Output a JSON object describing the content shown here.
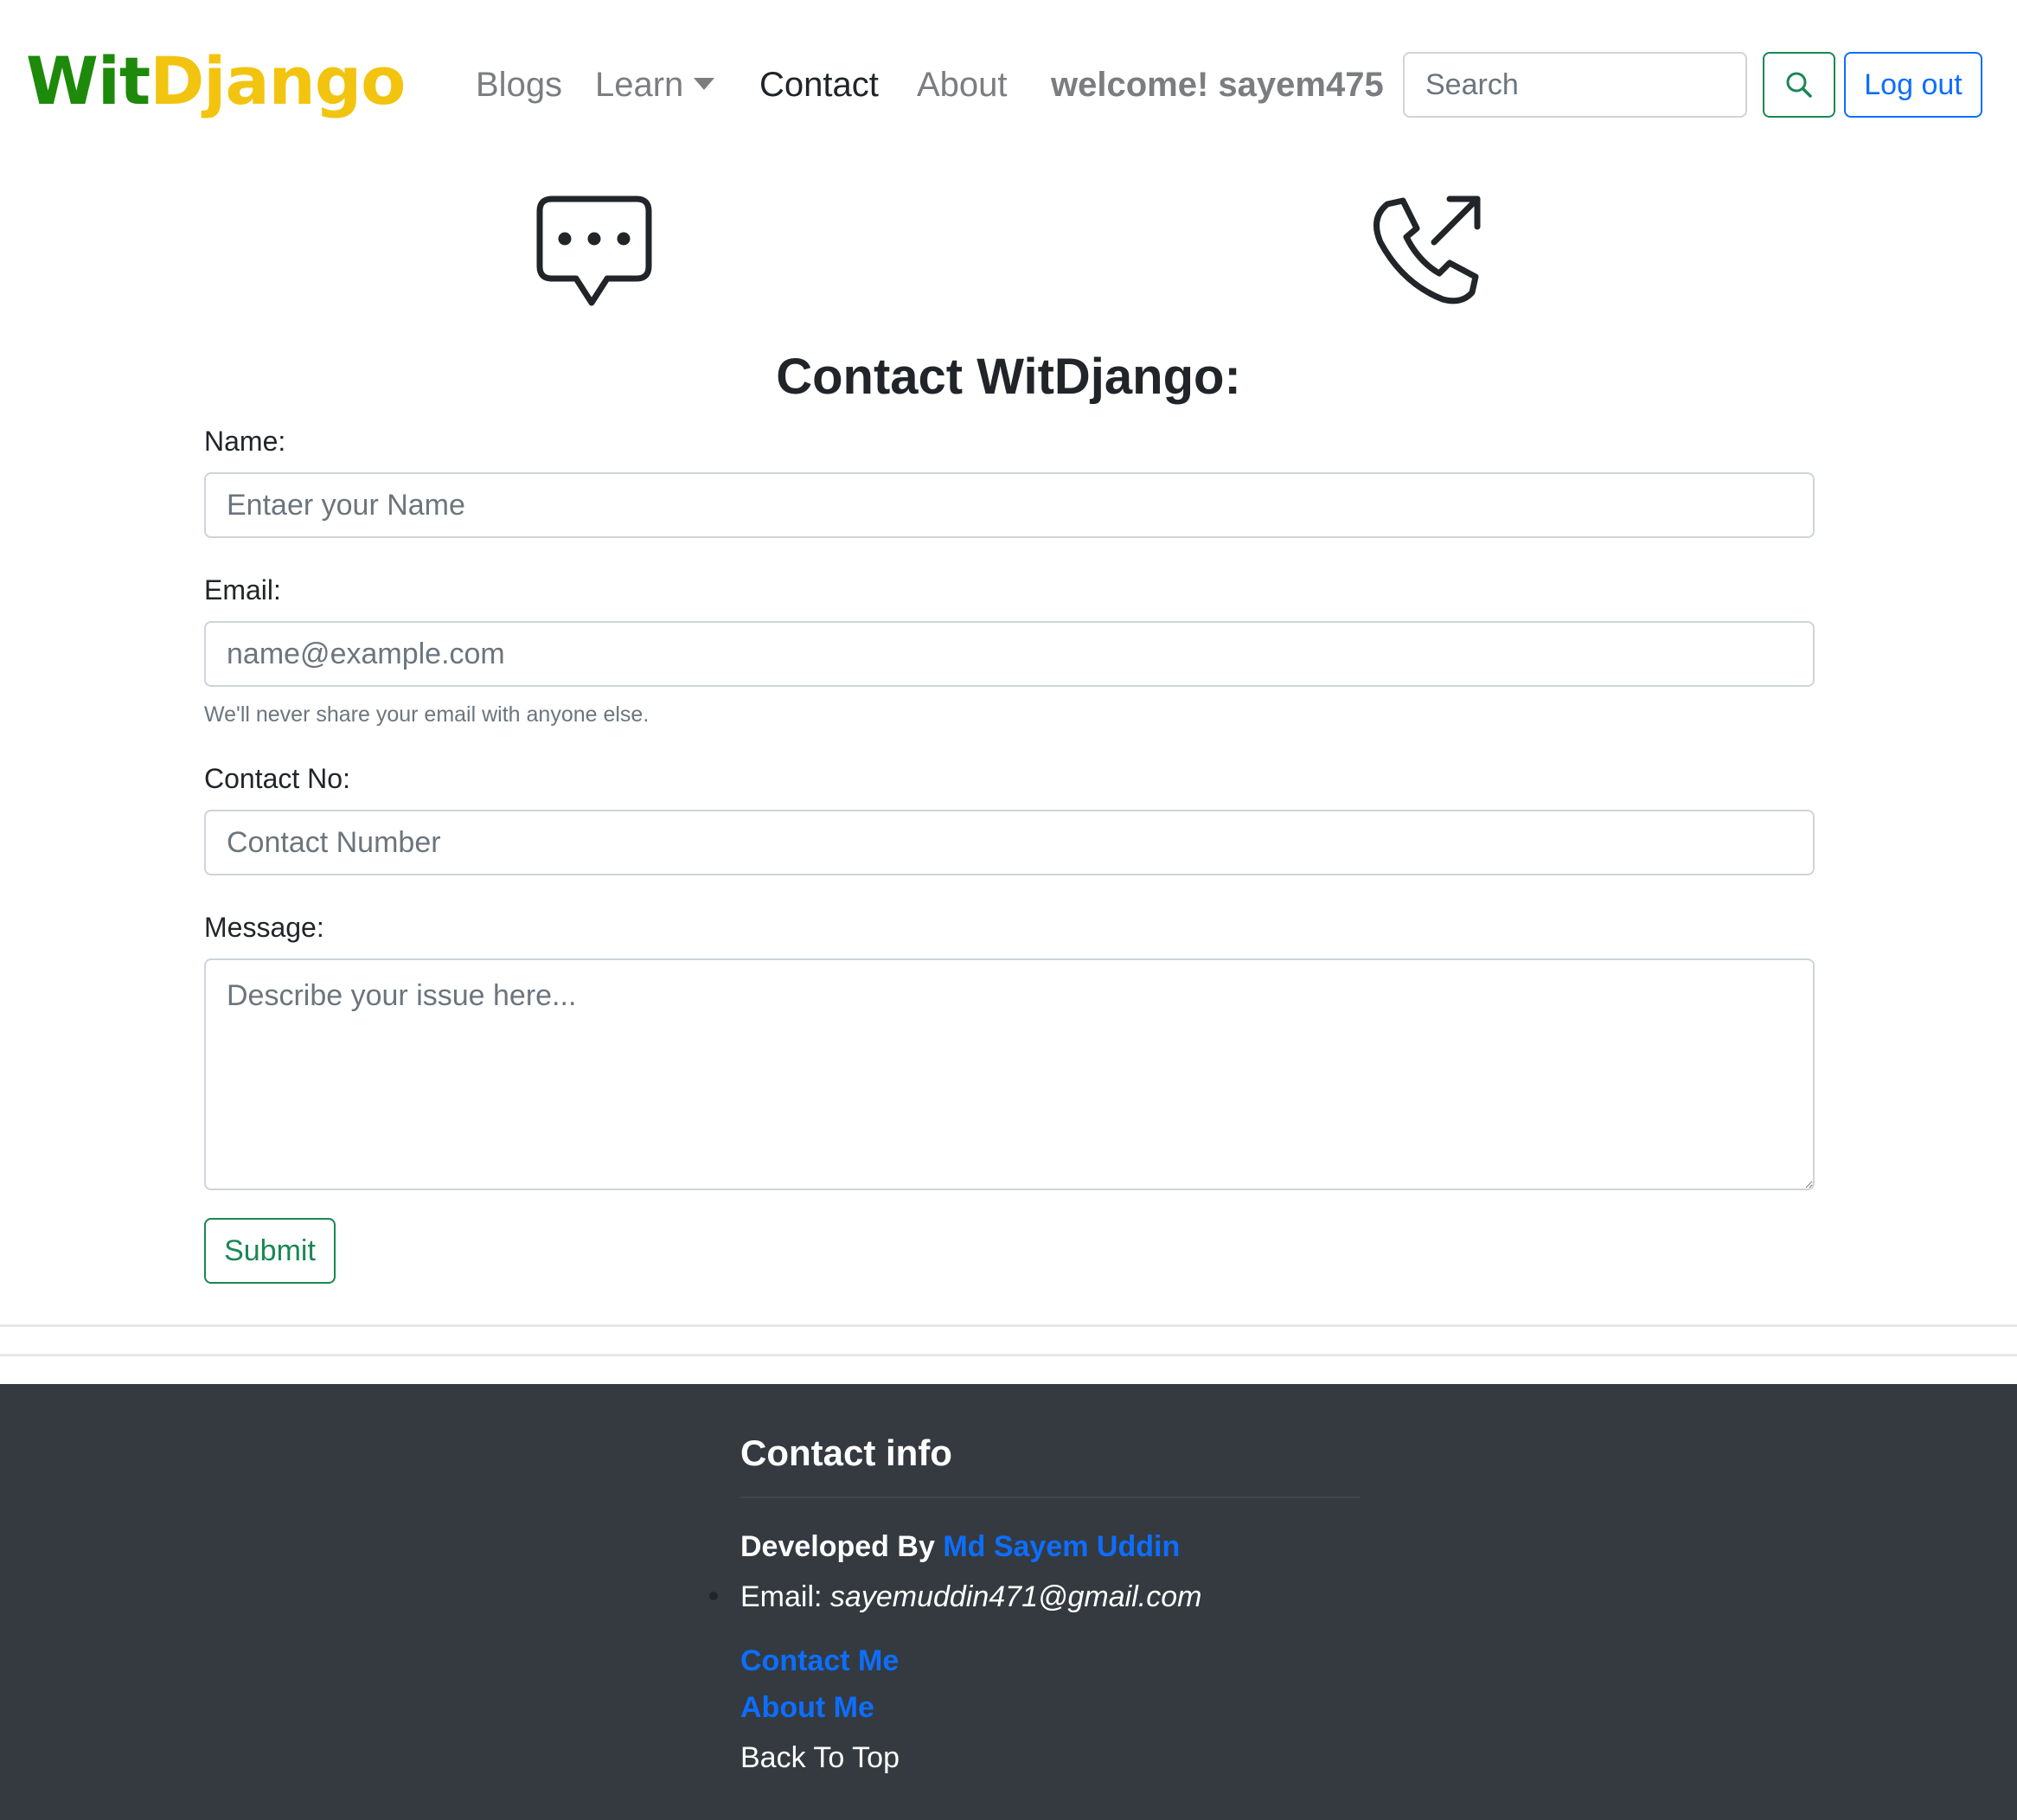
{
  "navbar": {
    "brand_part1": "Wit",
    "brand_part2": "Django",
    "links": {
      "blogs": "Blogs",
      "learn": "Learn",
      "contact": "Contact",
      "about": "About"
    },
    "welcome": "welcome! sayem475",
    "search_placeholder": "Search",
    "logout_label": "Log out"
  },
  "icons": {
    "left": "chat-dots-icon",
    "right": "phone-outgoing-icon"
  },
  "form": {
    "title": "Contact WitDjango:",
    "name_label": "Name:",
    "name_placeholder": "Entaer your Name",
    "email_label": "Email:",
    "email_placeholder": "name@example.com",
    "email_help": "We'll never share your email with anyone else.",
    "contact_label": "Contact No:",
    "contact_placeholder": "Contact Number",
    "message_label": "Message:",
    "message_placeholder": "Describe your issue here...",
    "submit_label": "Submit"
  },
  "footer": {
    "title": "Contact info",
    "developed_by": "Developed By",
    "developer_name": "Md Sayem Uddin",
    "email_label": "Email:",
    "email_value": "sayemuddin471@gmail.com",
    "contact_me": "Contact Me",
    "about_me": "About Me",
    "back_to_top": "Back To Top"
  },
  "colors": {
    "brand_green": "#1e8a0b",
    "brand_yellow": "#f2c40f",
    "primary": "#0d6efd",
    "success": "#198754",
    "footer_bg": "#343a40"
  }
}
